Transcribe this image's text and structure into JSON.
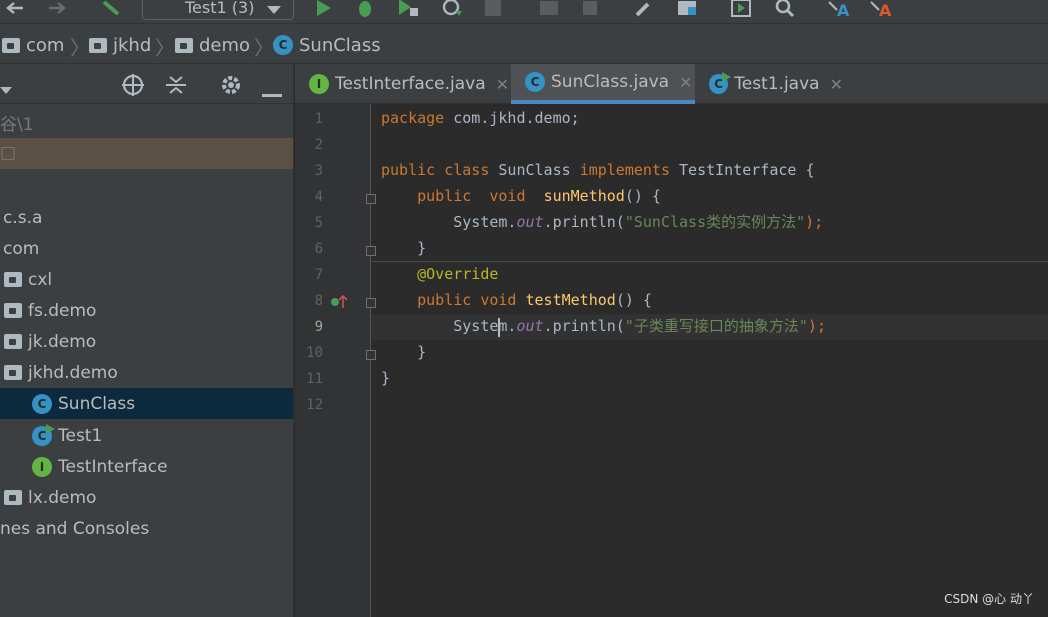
{
  "toolbar": {
    "run_config": "Test1 (3)"
  },
  "breadcrumb": {
    "items": [
      "com",
      "jkhd",
      "demo",
      "SunClass"
    ]
  },
  "project": {
    "partial_root": "谷\\1",
    "tree": [
      {
        "label": "c.s.a",
        "type": "package"
      },
      {
        "label": "com",
        "type": "package"
      },
      {
        "label": "cxl",
        "type": "folder"
      },
      {
        "label": "fs.demo",
        "type": "folder"
      },
      {
        "label": "jk.demo",
        "type": "folder"
      },
      {
        "label": "jkhd.demo",
        "type": "folder"
      },
      {
        "label": "SunClass",
        "type": "class",
        "selected": true
      },
      {
        "label": "Test1",
        "type": "class-main"
      },
      {
        "label": "TestInterface",
        "type": "interface"
      },
      {
        "label": "lx.demo",
        "type": "folder"
      },
      {
        "label": "nes and Consoles",
        "type": "text"
      }
    ]
  },
  "tabs": [
    {
      "label": "TestInterface.java",
      "icon": "interface-icon",
      "active": false
    },
    {
      "label": "SunClass.java",
      "icon": "class-icon",
      "active": true
    },
    {
      "label": "Test1.java",
      "icon": "class-run-icon",
      "active": false
    }
  ],
  "code": {
    "line_numbers": [
      "1",
      "2",
      "3",
      "4",
      "5",
      "6",
      "7",
      "8",
      "9",
      "10",
      "11",
      "12"
    ],
    "lines": {
      "l1": [
        "package",
        " com.jkhd.demo;"
      ],
      "l3": [
        "public",
        " ",
        "class",
        " SunClass ",
        "implements",
        " TestInterface {"
      ],
      "l4": [
        "    ",
        "public",
        "  ",
        "void",
        "  ",
        "sunMethod",
        "() {"
      ],
      "l5": [
        "        System.",
        "out",
        ".println(",
        "\"SunClass类的实例方法\"",
        ");"
      ],
      "l6": [
        "    }"
      ],
      "l7": [
        "    ",
        "@Override"
      ],
      "l8": [
        "    ",
        "public",
        " ",
        "void",
        " ",
        "testMethod",
        "() {"
      ],
      "l9": [
        "        System.",
        "out",
        ".println(",
        "\"子类重写接口的抽象方法\"",
        ");"
      ],
      "l10": [
        "    }"
      ],
      "l11": [
        "}"
      ]
    },
    "current_line": 9
  },
  "watermark": "CSDN @心 动丫",
  "colors": {
    "keyword": "#cc7832",
    "annotation": "#bbb529",
    "string": "#6a8759",
    "method": "#ffc66d",
    "field": "#9876aa",
    "selection": "#0d293e",
    "run_green": "#499c54"
  }
}
